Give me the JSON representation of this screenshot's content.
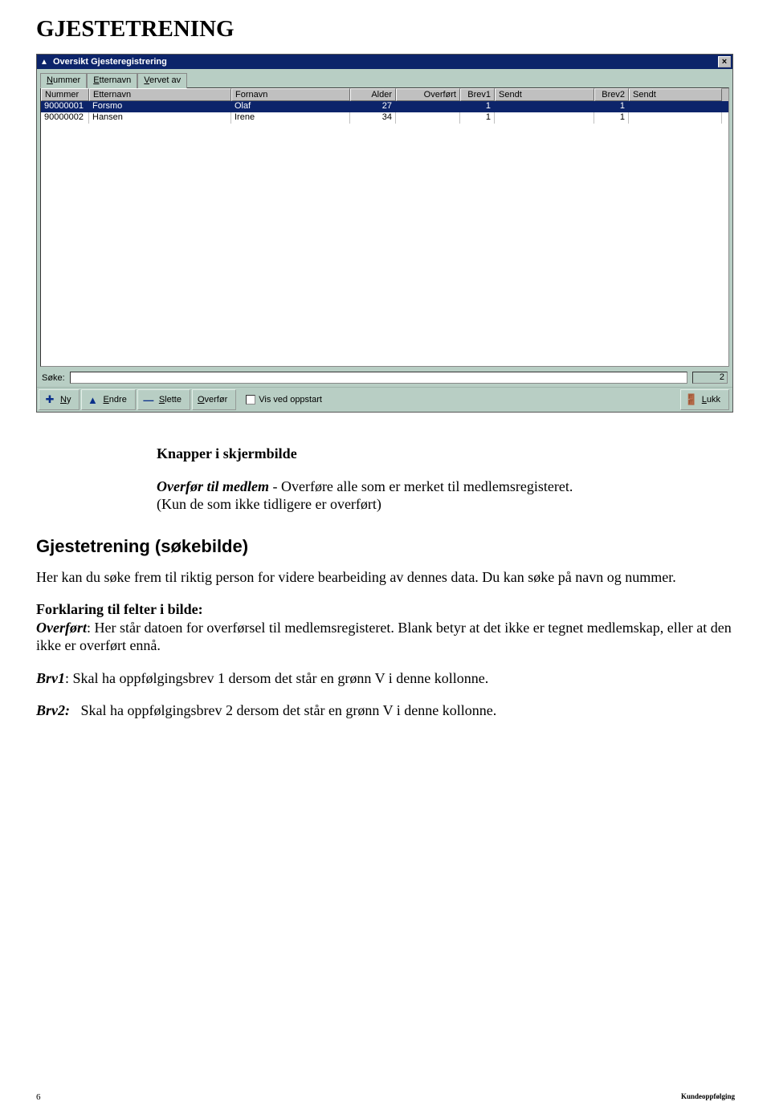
{
  "page_heading": "GJESTETRENING",
  "window": {
    "title": "Oversikt Gjesteregistrering",
    "close_glyph": "×",
    "icon_glyph": "▲",
    "tabs": [
      {
        "label_pre": "N",
        "label_rest": "ummer"
      },
      {
        "label_pre": "E",
        "label_rest": "tternavn"
      },
      {
        "label_pre": "V",
        "label_rest": "ervet av"
      }
    ],
    "columns": {
      "nummer": "Nummer",
      "etternavn": "Etternavn",
      "fornavn": "Fornavn",
      "alder": "Alder",
      "overfort": "Overført",
      "brev1": "Brev1",
      "sendt1": "Sendt",
      "brev2": "Brev2",
      "sendt2": "Sendt"
    },
    "rows": [
      {
        "nummer": "90000001",
        "etternavn": "Forsmo",
        "fornavn": "Olaf",
        "alder": "27",
        "overfort": "",
        "brev1": "1",
        "sendt1": "",
        "brev2": "1",
        "sendt2": ""
      },
      {
        "nummer": "90000002",
        "etternavn": "Hansen",
        "fornavn": "Irene",
        "alder": "34",
        "overfort": "",
        "brev1": "1",
        "sendt1": "",
        "brev2": "1",
        "sendt2": ""
      }
    ],
    "sok_label": "Søke:",
    "count": "2",
    "buttons": {
      "ny_pre": "N",
      "ny_rest": "y",
      "endre_pre": "E",
      "endre_rest": "ndre",
      "slette_pre": "S",
      "slette_rest": "lette",
      "overfor_pre": "O",
      "overfor_rest": "verfør",
      "lukk_pre": "L",
      "lukk_rest": "ukk"
    },
    "vis_pre": "V",
    "vis_rest": "is ved oppstart",
    "icons": {
      "ny": "✚",
      "endre": "▲",
      "slette": "—",
      "lukk": "🚪"
    }
  },
  "doc": {
    "knapper_heading": "Knapper i skjermbilde",
    "overfor_label": "Overfør til medlem",
    "overfor_text_1": "-  Overføre alle som er merket til medlemsregisteret.",
    "overfor_text_2": "(Kun de som ikke tidligere er overført)",
    "sokebilde_heading": "Gjestetrening  (søkebilde)",
    "soke_p": "Her kan du søke frem til riktig person for videre bearbeiding av dennes data. Du kan søke på navn og nummer.",
    "forklaring_h": "Forklaring til felter i bilde:",
    "overfort_label": "Overført",
    "overfort_text": ":  Her står datoen for overførsel til medlemsregisteret. Blank betyr at det ikke er tegnet medlemskap, eller at den ikke er overført ennå.",
    "brv1_label": "Brv1",
    "brv1_text": ":   Skal ha oppfølgingsbrev 1 dersom det står en grønn V i denne kollonne.",
    "brv2_label": "Brv2:",
    "brv2_text": "Skal ha oppfølgingsbrev 2 dersom det står  en grønn V i denne kollonne."
  },
  "footer": {
    "page": "6",
    "right": "Kundeoppfølging"
  }
}
